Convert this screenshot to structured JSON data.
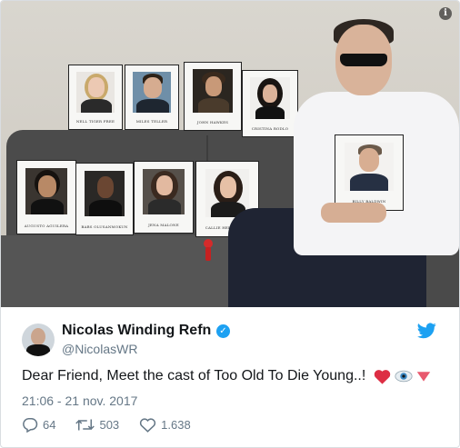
{
  "tweet": {
    "display_name": "Nicolas Winding Refn",
    "handle": "@NicolasWR",
    "text": "Dear Friend, Meet the cast of Too Old To Die Young..!",
    "emojis": [
      "heart-icon",
      "eye-icon",
      "red-triangle-icon"
    ],
    "timestamp": "21:06 - 21 nov. 2017",
    "replies": "64",
    "retweets": "503",
    "likes": "1.638"
  },
  "photo": {
    "headshots": [
      {
        "caption": "NELL TIGER FREE"
      },
      {
        "caption": "MILES TELLER"
      },
      {
        "caption": "JOHN HAWKES"
      },
      {
        "caption": "CRISTINA RODLO"
      },
      {
        "caption": "AUGUSTO AGUILERA"
      },
      {
        "caption": "BABS OLUSANMOKUN"
      },
      {
        "caption": "JENA MALONE"
      },
      {
        "caption": "CALLIE HERNANDEZ"
      },
      {
        "caption": "BILLY BALDWIN"
      }
    ]
  },
  "colors": {
    "brand_blue": "#1da1f2",
    "text_primary": "#14171a",
    "text_secondary": "#657786",
    "heart_red": "#e0245e"
  }
}
